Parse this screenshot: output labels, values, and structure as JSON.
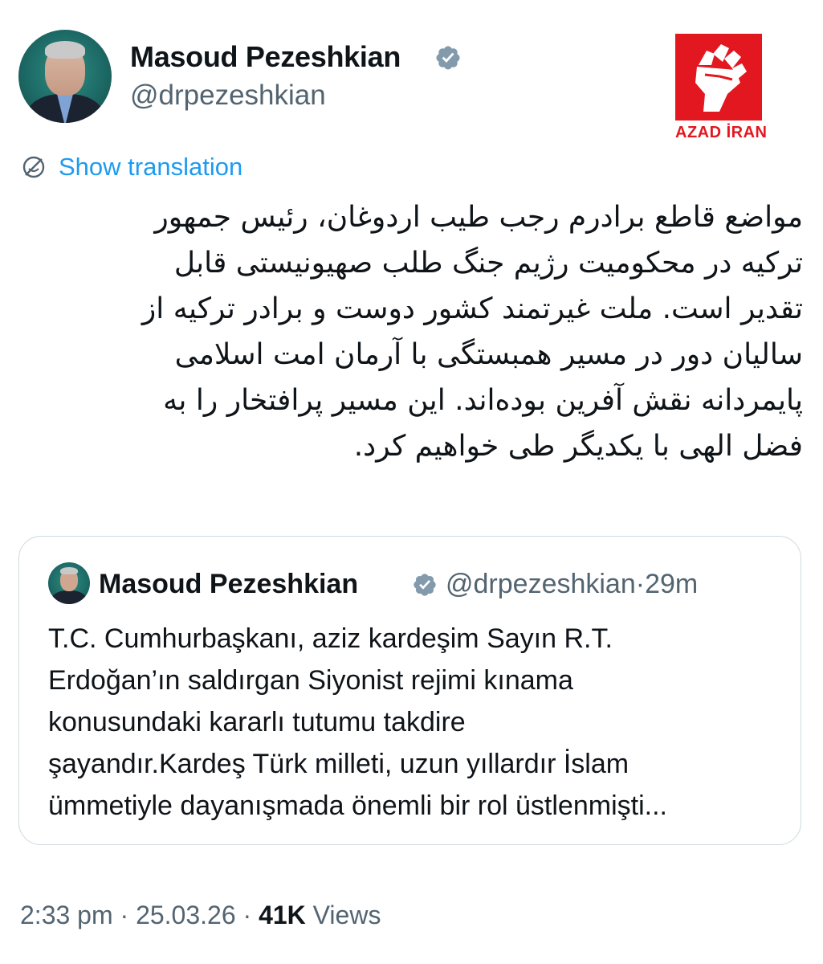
{
  "author": {
    "name": "Masoud Pezeshkian",
    "handle": "@drpezeshkian"
  },
  "watermark": {
    "text": "AZAD İRAN",
    "color": "#e3171f"
  },
  "translation": {
    "label": "Show translation",
    "icon": "translate-globe-icon"
  },
  "tweet": {
    "lines": [
      "مواضع قاطع برادرم رجب طیب اردوغان، رئیس جمهور",
      "ترکیه در محکومیت رژیم جنگ طلب صهیونیستی قابل",
      "تقدیر است. ملت غیرتمند کشور دوست و برادر ترکیه از",
      "سالیان دور در مسیر همبستگی با آرمان امت اسلامی",
      "پایمردانه نقش آفرین بوده‌اند. این مسیر پرافتخار را به",
      "فضل الهی با یکدیگر طی خواهیم کرد."
    ]
  },
  "quoted": {
    "name": "Masoud Pezeshkian",
    "handle": "@drpezeshkian",
    "separator": "·",
    "time": "29m",
    "lines": [
      "T.C. Cumhurbaşkanı, aziz kardeşim Sayın R.T.",
      "Erdoğan’ın saldırgan Siyonist rejimi kınama",
      "konusundaki kararlı tutumu takdire",
      "şayandır.Kardeş Türk milleti, uzun yıllardır İslam",
      "ümmetiyle dayanışmada önemli bir rol üstlenmişti..."
    ]
  },
  "footer": {
    "time": "2:33 pm",
    "separator": "·",
    "date": "25.03.26",
    "views_count": "41K",
    "views_label": "Views"
  },
  "colors": {
    "accent": "#1d9bf0",
    "secondary_text": "#536471",
    "border": "#cfd9de",
    "verified_badge": "#829aab"
  }
}
